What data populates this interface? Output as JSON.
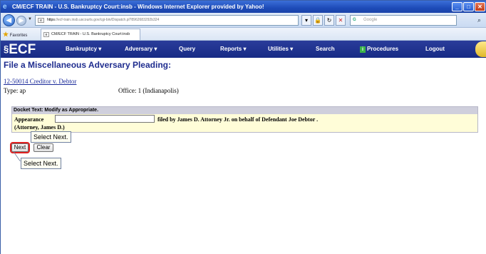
{
  "browser": {
    "title": "CM/ECF TRAIN - U.S. Bankruptcy Court:insb - Windows Internet Explorer provided by Yahoo!",
    "url_scheme": "https",
    "url": "://ecf-train.insb.uscourts.gov/cgi-bin/Dispatch.pl?8962683292b324",
    "search_placeholder": "Google",
    "favorites_label": "Favorites",
    "tab_title": "CM/ECF TRAIN - U.S. Bankruptcy Court:insb",
    "window_buttons": {
      "minimize": "_",
      "maximize": "□",
      "close": "✕"
    }
  },
  "ecf_nav": {
    "logo": "ECF",
    "items": [
      {
        "label": "Bankruptcy ▾"
      },
      {
        "label": "Adversary ▾"
      },
      {
        "label": "Query"
      },
      {
        "label": "Reports ▾"
      },
      {
        "label": "Utilities ▾"
      },
      {
        "label": "Search"
      },
      {
        "label": "Procedures"
      },
      {
        "label": "Logout"
      }
    ]
  },
  "page": {
    "title": "File a Miscellaneous Adversary Pleading:",
    "case_link": "12-50014 Creditor v. Debtor",
    "type_label": "Type: ap",
    "office_label": "Office: 1 (Indianapolis)"
  },
  "docket": {
    "header": "Docket Text: Modify as Appropriate.",
    "appearance_label": "Appearance",
    "appearance_value": "",
    "filed_by": "filed by James D. Attorney Jr. on behalf of Defendant Joe Debtor .",
    "attorney": "(Attorney, James D.)"
  },
  "callouts": {
    "first": "Select Next.",
    "second": "Select Next."
  },
  "buttons": {
    "next": "Next",
    "clear": "Clear"
  }
}
